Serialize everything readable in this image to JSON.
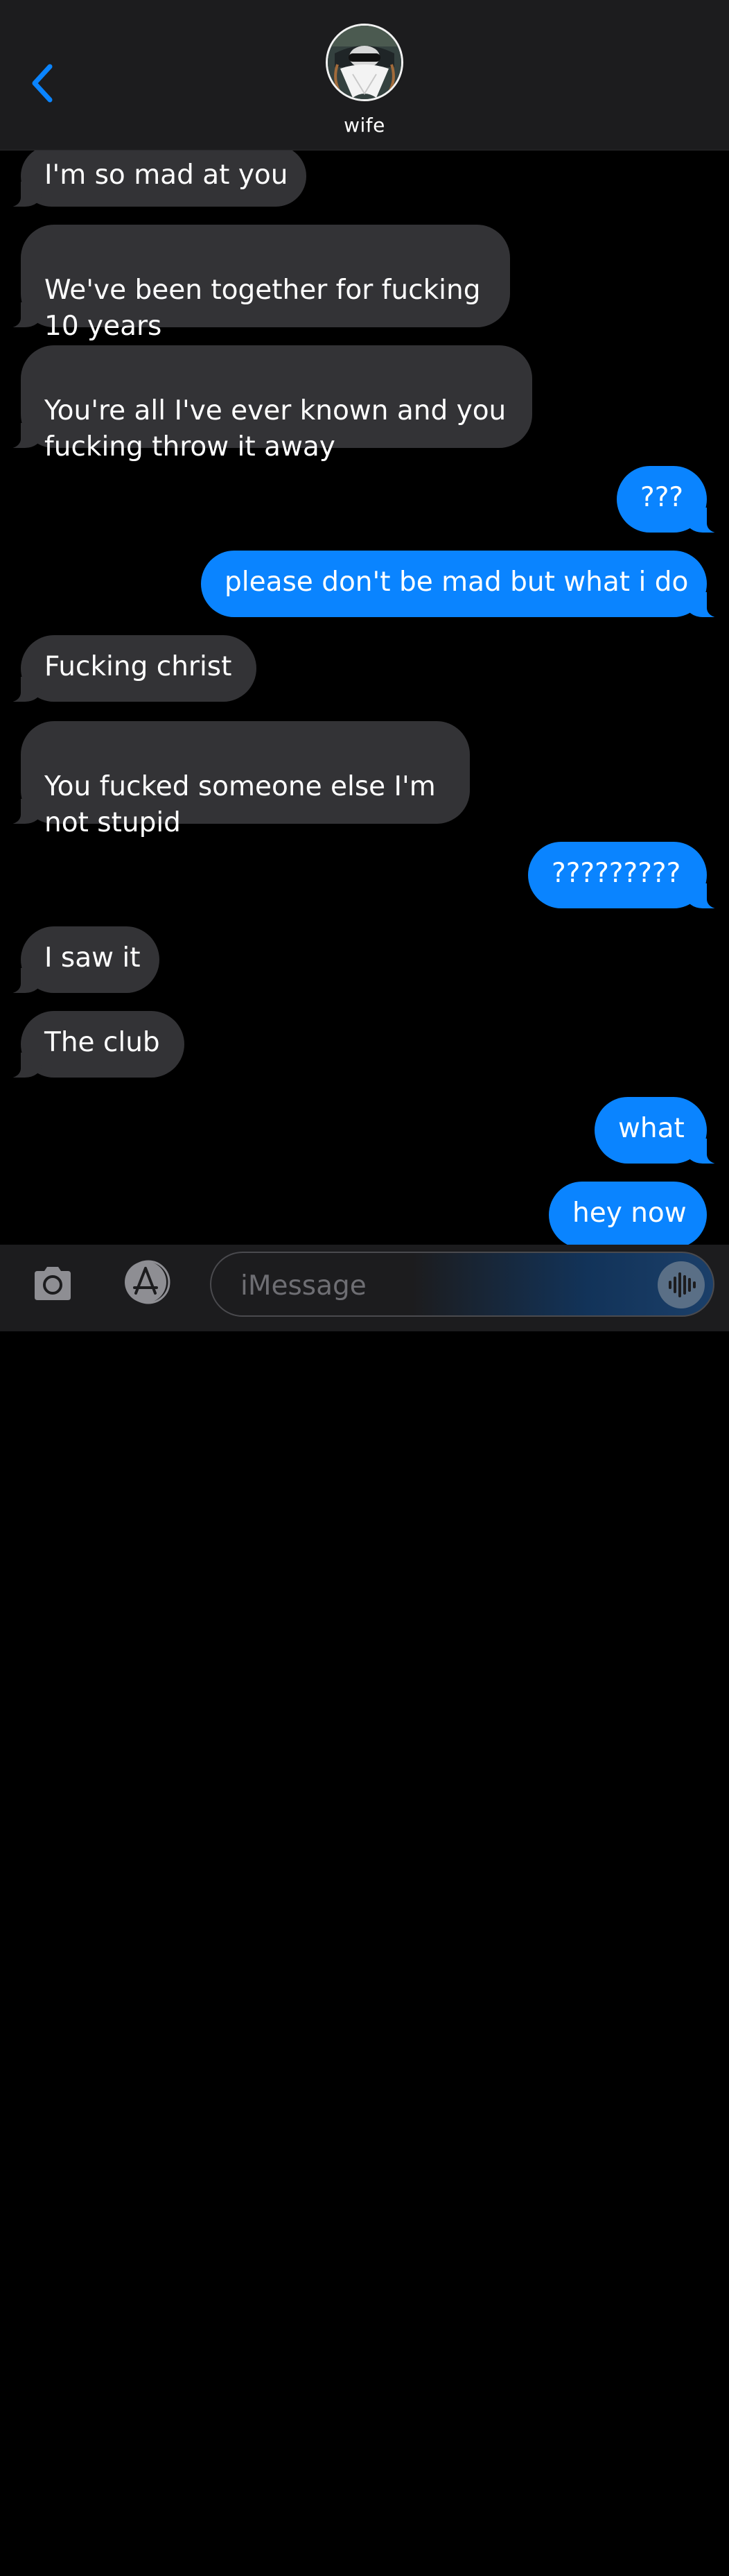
{
  "header": {
    "contact_name": "wife",
    "back_icon": "chevron-left-icon",
    "avatar_icon": "contact-avatar"
  },
  "messages": [
    {
      "from": "received",
      "text": "I'm so mad at you"
    },
    {
      "from": "received",
      "text": "We've been together for fucking\n10 years"
    },
    {
      "from": "received",
      "text": "You're all I've ever known and you\nfucking throw it away"
    },
    {
      "from": "sent",
      "text": "???"
    },
    {
      "from": "sent",
      "text": "please don't be mad but what i do"
    },
    {
      "from": "received",
      "text": "Fucking christ"
    },
    {
      "from": "received",
      "text": "You fucked someone else I'm\nnot stupid"
    },
    {
      "from": "sent",
      "text": "?????????"
    },
    {
      "from": "received",
      "text": "I saw it"
    },
    {
      "from": "received",
      "text": "The club"
    },
    {
      "from": "sent",
      "text": "what"
    },
    {
      "from": "sent",
      "text": "hey now"
    }
  ],
  "input_bar": {
    "placeholder": "iMessage",
    "value": "",
    "camera_icon": "camera-icon",
    "apps_icon": "app-store-icon",
    "audio_icon": "audio-waveform-icon"
  },
  "colors": {
    "header_bg": "#1c1c1e",
    "received_bubble": "#333336",
    "sent_bubble": "#0a84ff",
    "accent": "#0a84ff"
  }
}
